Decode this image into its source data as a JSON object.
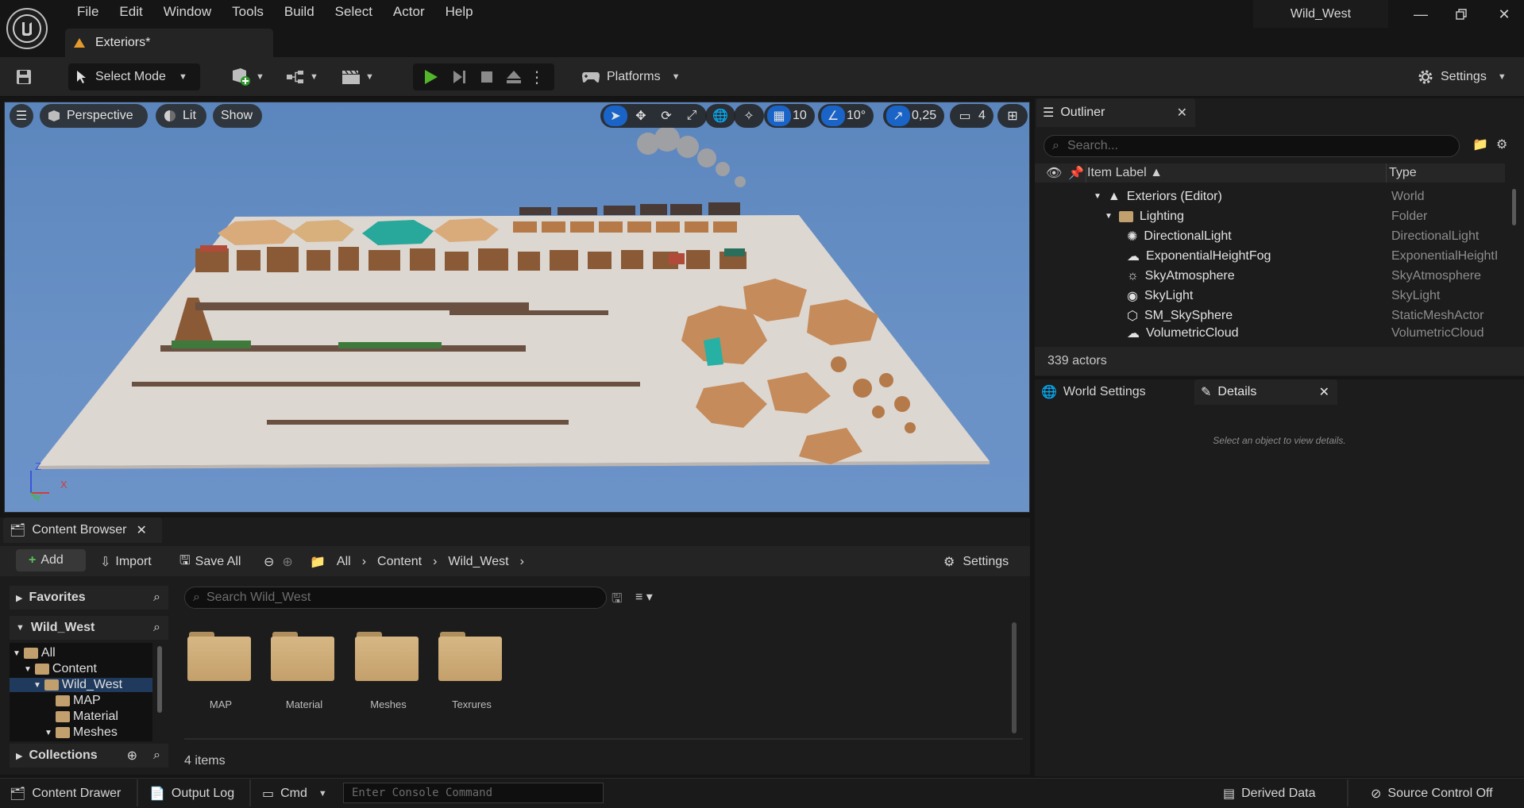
{
  "window": {
    "title": "Wild_West",
    "document_tab": "Exteriors*"
  },
  "menu": [
    "File",
    "Edit",
    "Window",
    "Tools",
    "Build",
    "Select",
    "Actor",
    "Help"
  ],
  "toolbar": {
    "select_mode": "Select Mode",
    "platforms": "Platforms",
    "settings": "Settings"
  },
  "viewport": {
    "perspective": "Perspective",
    "lit": "Lit",
    "show": "Show",
    "grid_snap": "10",
    "rotation_snap": "10°",
    "scale_snap": "0,25",
    "camera_speed": "4",
    "axis": {
      "z": "Z",
      "x": "X",
      "y": "Y"
    }
  },
  "outliner": {
    "title": "Outliner",
    "search_placeholder": "Search...",
    "col_label": "Item Label",
    "col_type": "Type",
    "rows": [
      {
        "label": "Exteriors (Editor)",
        "type": "World"
      },
      {
        "label": "Lighting",
        "type": "Folder"
      },
      {
        "label": "DirectionalLight",
        "type": "DirectionalLight"
      },
      {
        "label": "ExponentialHeightFog",
        "type": "ExponentialHeightI"
      },
      {
        "label": "SkyAtmosphere",
        "type": "SkyAtmosphere"
      },
      {
        "label": "SkyLight",
        "type": "SkyLight"
      },
      {
        "label": "SM_SkySphere",
        "type": "StaticMeshActor"
      },
      {
        "label": "VolumetricCloud",
        "type": "VolumetricCloud"
      }
    ],
    "actor_count": "339 actors"
  },
  "details": {
    "world_settings_tab": "World Settings",
    "details_tab": "Details",
    "empty_message": "Select an object to view details."
  },
  "content_browser": {
    "tab": "Content Browser",
    "add": "Add",
    "import": "Import",
    "save_all": "Save All",
    "breadcrumb": [
      "All",
      "Content",
      "Wild_West"
    ],
    "settings": "Settings",
    "favorites": "Favorites",
    "root_section": "Wild_West",
    "tree": [
      "All",
      "Content",
      "Wild_West",
      "MAP",
      "Material",
      "Meshes"
    ],
    "collections": "Collections",
    "search_placeholder": "Search Wild_West",
    "folders": [
      "MAP",
      "Material",
      "Meshes",
      "Texrures"
    ],
    "item_count": "4 items"
  },
  "statusbar": {
    "content_drawer": "Content Drawer",
    "output_log": "Output Log",
    "cmd": "Cmd",
    "console_placeholder": "Enter Console Command",
    "derived_data": "Derived Data",
    "source_control": "Source Control Off"
  }
}
